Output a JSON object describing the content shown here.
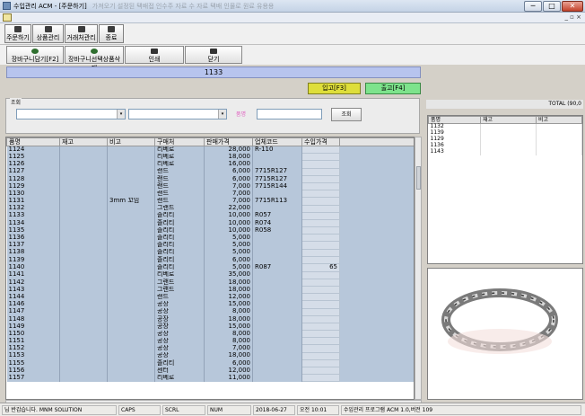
{
  "window": {
    "title": "수입관리 ACM - [주문하기]",
    "title_faint": "가져오기  설정된  택배접  인수주 자료  수 자료  택배 인물로  원료 유용용",
    "min": "─",
    "max": "□",
    "close": "✕"
  },
  "mdi": {
    "buttons": "_ ▫ ×"
  },
  "toolbar": [
    {
      "label": "주문하기",
      "icon": "order-icon"
    },
    {
      "label": "상품관리",
      "icon": "product-icon"
    },
    {
      "label": "거래처관리",
      "icon": "client-icon"
    },
    {
      "label": "종료",
      "icon": "exit-icon"
    }
  ],
  "toolbar2": [
    {
      "label": "장바구니담기[F2]",
      "icon": "cart-icon"
    },
    {
      "label": "장바구니선택상품삭제",
      "icon": "cart-delete-icon"
    },
    {
      "label": "인쇄",
      "icon": "print-icon"
    },
    {
      "label": "닫기",
      "icon": "close-icon"
    }
  ],
  "banner": "1133",
  "actions": {
    "in": "입고[F3]",
    "out": "출고[F4]"
  },
  "search": {
    "group_label": "조회",
    "name_label": "품명",
    "button": "조회",
    "arrow": "▾"
  },
  "grid": {
    "columns": [
      "품명",
      "재고",
      "비고",
      "구매처",
      "판매가격",
      "업체코드",
      "수입가격"
    ],
    "rows": [
      [
        "1124",
        "",
        "",
        "리베로",
        "28,000",
        "R-110",
        ""
      ],
      [
        "1125",
        "",
        "",
        "리베로",
        "18,000",
        "",
        ""
      ],
      [
        "1126",
        "",
        "",
        "리베로",
        "16,000",
        "",
        ""
      ],
      [
        "1127",
        "",
        "",
        "랜드",
        "6,000",
        "7715R127",
        ""
      ],
      [
        "1128",
        "",
        "",
        "랜드",
        "6,000",
        "7715R127",
        ""
      ],
      [
        "1129",
        "",
        "",
        "랜드",
        "7,000",
        "7715R144",
        ""
      ],
      [
        "1130",
        "",
        "",
        "랜드",
        "7,000",
        "",
        ""
      ],
      [
        "1131",
        "",
        "3mm 꼬임",
        "랜드",
        "7,000",
        "7715R113",
        ""
      ],
      [
        "1132",
        "",
        "",
        "그랜드",
        "22,000",
        "",
        ""
      ],
      [
        "1133",
        "",
        "",
        "졸리티",
        "10,000",
        "R057",
        ""
      ],
      [
        "1134",
        "",
        "",
        "졸리티",
        "10,000",
        "R074",
        ""
      ],
      [
        "1135",
        "",
        "",
        "졸리티",
        "10,000",
        "R058",
        ""
      ],
      [
        "1136",
        "",
        "",
        "졸리티",
        "5,000",
        "",
        ""
      ],
      [
        "1137",
        "",
        "",
        "졸리티",
        "5,000",
        "",
        ""
      ],
      [
        "1138",
        "",
        "",
        "졸리티",
        "5,000",
        "",
        ""
      ],
      [
        "1139",
        "",
        "",
        "졸리티",
        "6,000",
        "",
        ""
      ],
      [
        "1140",
        "",
        "",
        "졸리티",
        "5,000",
        "R087",
        "65"
      ],
      [
        "1141",
        "",
        "",
        "리베로",
        "35,000",
        "",
        ""
      ],
      [
        "1142",
        "",
        "",
        "그랜드",
        "18,000",
        "",
        ""
      ],
      [
        "1143",
        "",
        "",
        "그랜드",
        "18,000",
        "",
        ""
      ],
      [
        "1144",
        "",
        "",
        "랜드",
        "12,000",
        "",
        ""
      ],
      [
        "1146",
        "",
        "",
        "공장",
        "15,000",
        "",
        ""
      ],
      [
        "1147",
        "",
        "",
        "공장",
        "8,000",
        "",
        ""
      ],
      [
        "1148",
        "",
        "",
        "공장",
        "18,000",
        "",
        ""
      ],
      [
        "1149",
        "",
        "",
        "공장",
        "15,000",
        "",
        ""
      ],
      [
        "1150",
        "",
        "",
        "공장",
        "8,000",
        "",
        ""
      ],
      [
        "1151",
        "",
        "",
        "공장",
        "8,000",
        "",
        ""
      ],
      [
        "1152",
        "",
        "",
        "공장",
        "7,000",
        "",
        ""
      ],
      [
        "1153",
        "",
        "",
        "공장",
        "18,000",
        "",
        ""
      ],
      [
        "1155",
        "",
        "",
        "졸리티",
        "6,000",
        "",
        ""
      ],
      [
        "1156",
        "",
        "",
        "센터",
        "12,000",
        "",
        ""
      ],
      [
        "1157",
        "",
        "",
        "리베로",
        "11,000",
        "",
        ""
      ]
    ]
  },
  "total": "TOTAL (90,0",
  "right_grid": {
    "columns": [
      "품명",
      "재고",
      "비고"
    ],
    "rows": [
      "1132",
      "1139",
      "1129",
      "1136",
      "1143"
    ]
  },
  "status": {
    "welcome": "님 반갑습니다. MNM SOLUTION",
    "caps": "CAPS",
    "scrl": "SCRL",
    "num": "NUM",
    "date": "2018-06-27",
    "time": "오전 10:01",
    "program": "수입관리 프로그램 ACM 1.0,버전 109"
  }
}
